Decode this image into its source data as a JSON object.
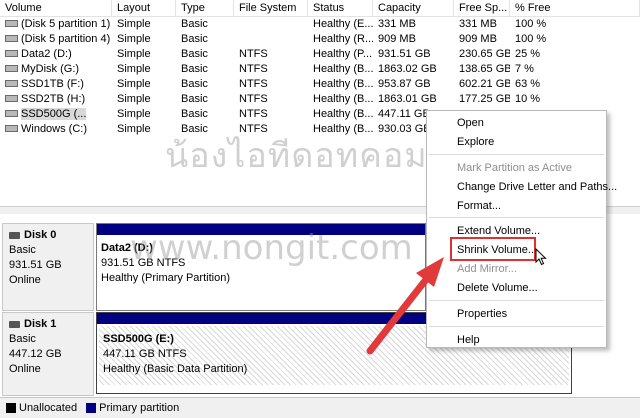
{
  "table": {
    "headers": [
      "Volume",
      "Layout",
      "Type",
      "File System",
      "Status",
      "Capacity",
      "Free Sp...",
      "% Free"
    ],
    "rows": [
      {
        "volume": "(Disk 5 partition 1)",
        "layout": "Simple",
        "type": "Basic",
        "fs": "",
        "status": "Healthy (E...",
        "capacity": "331 MB",
        "free": "331 MB",
        "pct": "100 %"
      },
      {
        "volume": "(Disk 5 partition 4)",
        "layout": "Simple",
        "type": "Basic",
        "fs": "",
        "status": "Healthy (R...",
        "capacity": "909 MB",
        "free": "909 MB",
        "pct": "100 %"
      },
      {
        "volume": "Data2 (D:)",
        "layout": "Simple",
        "type": "Basic",
        "fs": "NTFS",
        "status": "Healthy (P...",
        "capacity": "931.51 GB",
        "free": "230.65 GB",
        "pct": "25 %"
      },
      {
        "volume": "MyDisk (G:)",
        "layout": "Simple",
        "type": "Basic",
        "fs": "NTFS",
        "status": "Healthy (B...",
        "capacity": "1863.02 GB",
        "free": "138.65 GB",
        "pct": "7 %"
      },
      {
        "volume": "SSD1TB (F:)",
        "layout": "Simple",
        "type": "Basic",
        "fs": "NTFS",
        "status": "Healthy (B...",
        "capacity": "953.87 GB",
        "free": "602.21 GB",
        "pct": "63 %"
      },
      {
        "volume": "SSD2TB (H:)",
        "layout": "Simple",
        "type": "Basic",
        "fs": "NTFS",
        "status": "Healthy (B...",
        "capacity": "1863.01 GB",
        "free": "177.25 GB",
        "pct": "10 %"
      },
      {
        "volume": "SSD500G (...",
        "layout": "Simple",
        "type": "Basic",
        "fs": "NTFS",
        "status": "Healthy (B...",
        "capacity": "447.11 GB",
        "free": "",
        "pct": ""
      },
      {
        "volume": "Windows (C:)",
        "layout": "Simple",
        "type": "Basic",
        "fs": "NTFS",
        "status": "Healthy (B...",
        "capacity": "930.03 GB",
        "free": "",
        "pct": ""
      }
    ]
  },
  "disks": [
    {
      "name": "Disk 0",
      "type": "Basic",
      "size": "931.51 GB",
      "state": "Online",
      "partition": {
        "name": "Data2  (D:)",
        "size": "931.51 GB NTFS",
        "status": "Healthy (Primary Partition)"
      }
    },
    {
      "name": "Disk 1",
      "type": "Basic",
      "size": "447.12 GB",
      "state": "Online",
      "partition": {
        "name": "SSD500G  (E:)",
        "size": "447.11 GB NTFS",
        "status": "Healthy (Basic Data Partition)"
      }
    }
  ],
  "legend": {
    "unallocated": "Unallocated",
    "primary": "Primary partition"
  },
  "context_menu": {
    "open": "Open",
    "explore": "Explore",
    "mark_active": "Mark Partition as Active",
    "change_letter": "Change Drive Letter and Paths...",
    "format": "Format...",
    "extend": "Extend Volume...",
    "shrink": "Shrink Volume...",
    "add_mirror": "Add Mirror...",
    "delete": "Delete Volume...",
    "properties": "Properties",
    "help": "Help"
  },
  "watermark": {
    "thai": "น้องไอทีดอทคอม",
    "url": "www.nongit.com"
  },
  "colors": {
    "primary_partition": "#000080",
    "highlight_box": "#e03030",
    "arrow": "#e03a3a"
  }
}
